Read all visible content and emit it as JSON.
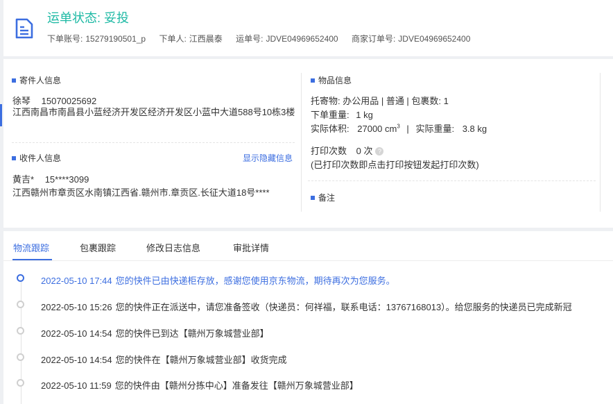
{
  "header": {
    "status_label": "运单状态:",
    "status_value": "妥投",
    "account_label": "下单账号:",
    "account_value": "15279190501_p",
    "orderer_label": "下单人:",
    "orderer_value": "江西晨泰",
    "waybill_label": "运单号:",
    "waybill_value": "JDVE04969652400",
    "merchant_order_label": "商家订单号:",
    "merchant_order_value": "JDVE04969652400"
  },
  "sender": {
    "title": "寄件人信息",
    "name": "徐琴",
    "phone": "15070025692",
    "address": "江西南昌市南昌县小蓝经济开发区经济开发区小蓝中大道588号10栋3楼"
  },
  "recipient": {
    "title": "收件人信息",
    "toggle_label": "显示隐藏信息",
    "name": "黄吉*",
    "phone": "15****3099",
    "address": "江西赣州市章贡区水南镇江西省.赣州市.章贡区.长征大道18号****"
  },
  "goods": {
    "title": "物品信息",
    "line1": "托寄物: 办公用品 | 普通 | 包裹数: 1",
    "weight_label": "下单重量:",
    "weight_value": "1 kg",
    "volume_label": "实际体积:",
    "volume_value": "27000 cm",
    "volume_unit_sup": "3",
    "actual_weight_label": "实际重量:",
    "actual_weight_value": "3.8 kg",
    "print_label": "打印次数",
    "print_value": "0 次",
    "print_note": "(已打印次数即点击打印按钮发起打印次数)"
  },
  "remarks": {
    "title": "备注"
  },
  "tabs": [
    "物流跟踪",
    "包裹跟踪",
    "修改日志信息",
    "审批详情"
  ],
  "tracking": [
    {
      "time": "2022-05-10 17:44",
      "text": "您的快件已由快递柜存放，感谢您使用京东物流，期待再次为您服务。"
    },
    {
      "time": "2022-05-10 15:26",
      "text": "您的快件正在派送中，请您准备签收（快递员：何祥福，联系电话：13767168013）。给您服务的快递员已完成新冠"
    },
    {
      "time": "2022-05-10 14:54",
      "text": "您的快件已到达【赣州万象城营业部】"
    },
    {
      "time": "2022-05-10 14:54",
      "text": "您的快件在【赣州万象城营业部】收货完成"
    },
    {
      "time": "2022-05-10 11:59",
      "text": "您的快件由【赣州分拣中心】准备发往【赣州万象城营业部】"
    }
  ],
  "colors": {
    "status": "#1db9a4",
    "accent": "#3c6ee0"
  }
}
